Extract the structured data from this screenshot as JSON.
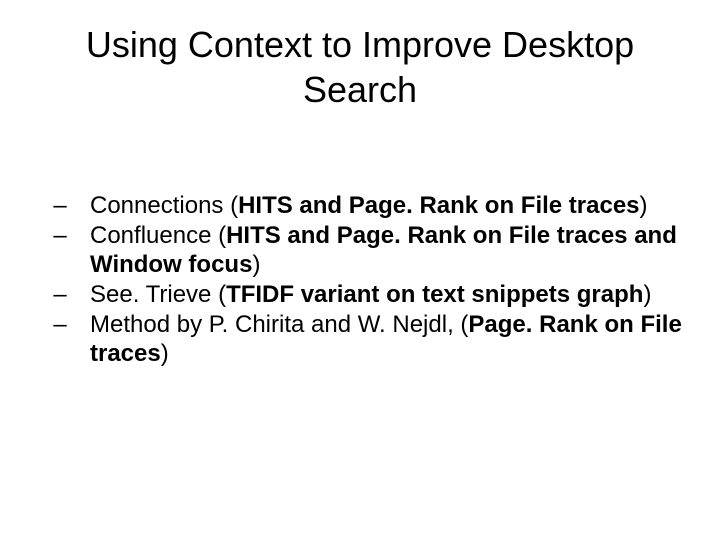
{
  "title": "Using Context to Improve Desktop Search",
  "dash": "–",
  "items": [
    {
      "pre": "Connections (",
      "bold": "HITS and Page. Rank on File traces",
      "post": ")"
    },
    {
      "pre": "Confluence (",
      "bold": "HITS and Page. Rank on File traces and Window focus",
      "post": ")"
    },
    {
      "pre": "See. Trieve (",
      "bold": "TFIDF variant on text snippets graph",
      "post": ")"
    },
    {
      "pre": "Method by P. Chirita and W. Nejdl, (",
      "bold": "Page. Rank on File traces",
      "post": ")"
    }
  ]
}
